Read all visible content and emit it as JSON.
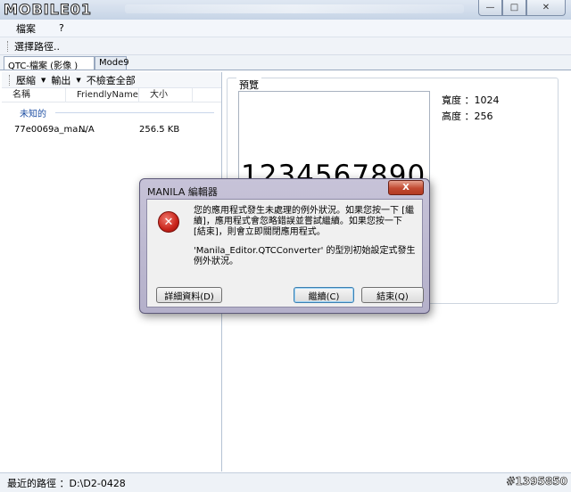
{
  "watermark_logo": "MOBILE01",
  "window": {
    "minimize": "—",
    "maximize": "□",
    "close": "✕"
  },
  "menu": {
    "file": "檔案",
    "help": "?"
  },
  "toolbar": {
    "select_path": "選擇路徑.."
  },
  "tabs": {
    "qtc": "QTC-檔案 (影像 )",
    "mode9": "Mode9"
  },
  "left_toolbar": {
    "compress": "壓縮",
    "export": "輸出",
    "uncheck_all": "不檢查全部"
  },
  "list": {
    "columns": [
      "名稱",
      "FriendlyName",
      "大小"
    ],
    "group": "未知的",
    "rows": [
      {
        "name": "77e0069a_ma...",
        "friendly": "N/A",
        "size": "256.5 KB"
      }
    ]
  },
  "preview": {
    "label": "預覽",
    "digits": "1234567890",
    "width_label": "寬度 ：1024",
    "height_label": "高度 ：256"
  },
  "status": {
    "text": "最近的路徑   ：D:\\D2-0428"
  },
  "watermark_id": "#1395850",
  "dialog": {
    "title": "MANILA 編輯器",
    "close": "X",
    "message": "您的應用程式發生未處理的例外狀況。如果您按一下 [繼續]，應用程式會忽略錯誤並嘗試繼續。如果您按一下 [結束]，則會立即關閉應用程式。",
    "detail": "'Manila_Editor.QTCConverter' 的型別初始設定式發生例外狀況。",
    "details_button": "詳細資料(D)",
    "continue_button": "繼續(C)",
    "quit_button": "結束(Q)"
  }
}
